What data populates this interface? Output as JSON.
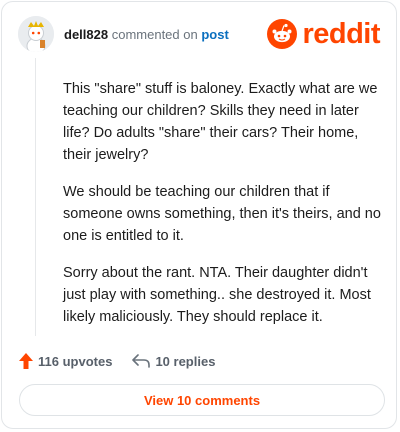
{
  "header": {
    "username": "dell828",
    "action_text": "commented on",
    "post_link": "post",
    "brand": "reddit"
  },
  "comment": {
    "paragraphs": [
      "This \"share\" stuff is baloney. Exactly what are we teaching our children? Skills they need in later life? Do adults \"share\" their cars? Their home, their jewelry?",
      "We should be teaching our children that if someone owns something, then it's theirs, and no one is entitled to it.",
      "Sorry about the rant. NTA. Their daughter didn't just play with something.. she destroyed it. Most likely maliciously. They should replace it."
    ]
  },
  "footer": {
    "upvotes_label": "116 upvotes",
    "replies_label": "10 replies"
  },
  "view_button_label": "View 10 comments",
  "colors": {
    "brand": "#ff4500",
    "link": "#0a6fbf",
    "muted": "#6a737c"
  },
  "icons": {
    "avatar": "snoo-avatar",
    "logo": "reddit-logo-icon",
    "upvote": "upvote-arrow-icon",
    "reply": "reply-arrow-icon"
  }
}
